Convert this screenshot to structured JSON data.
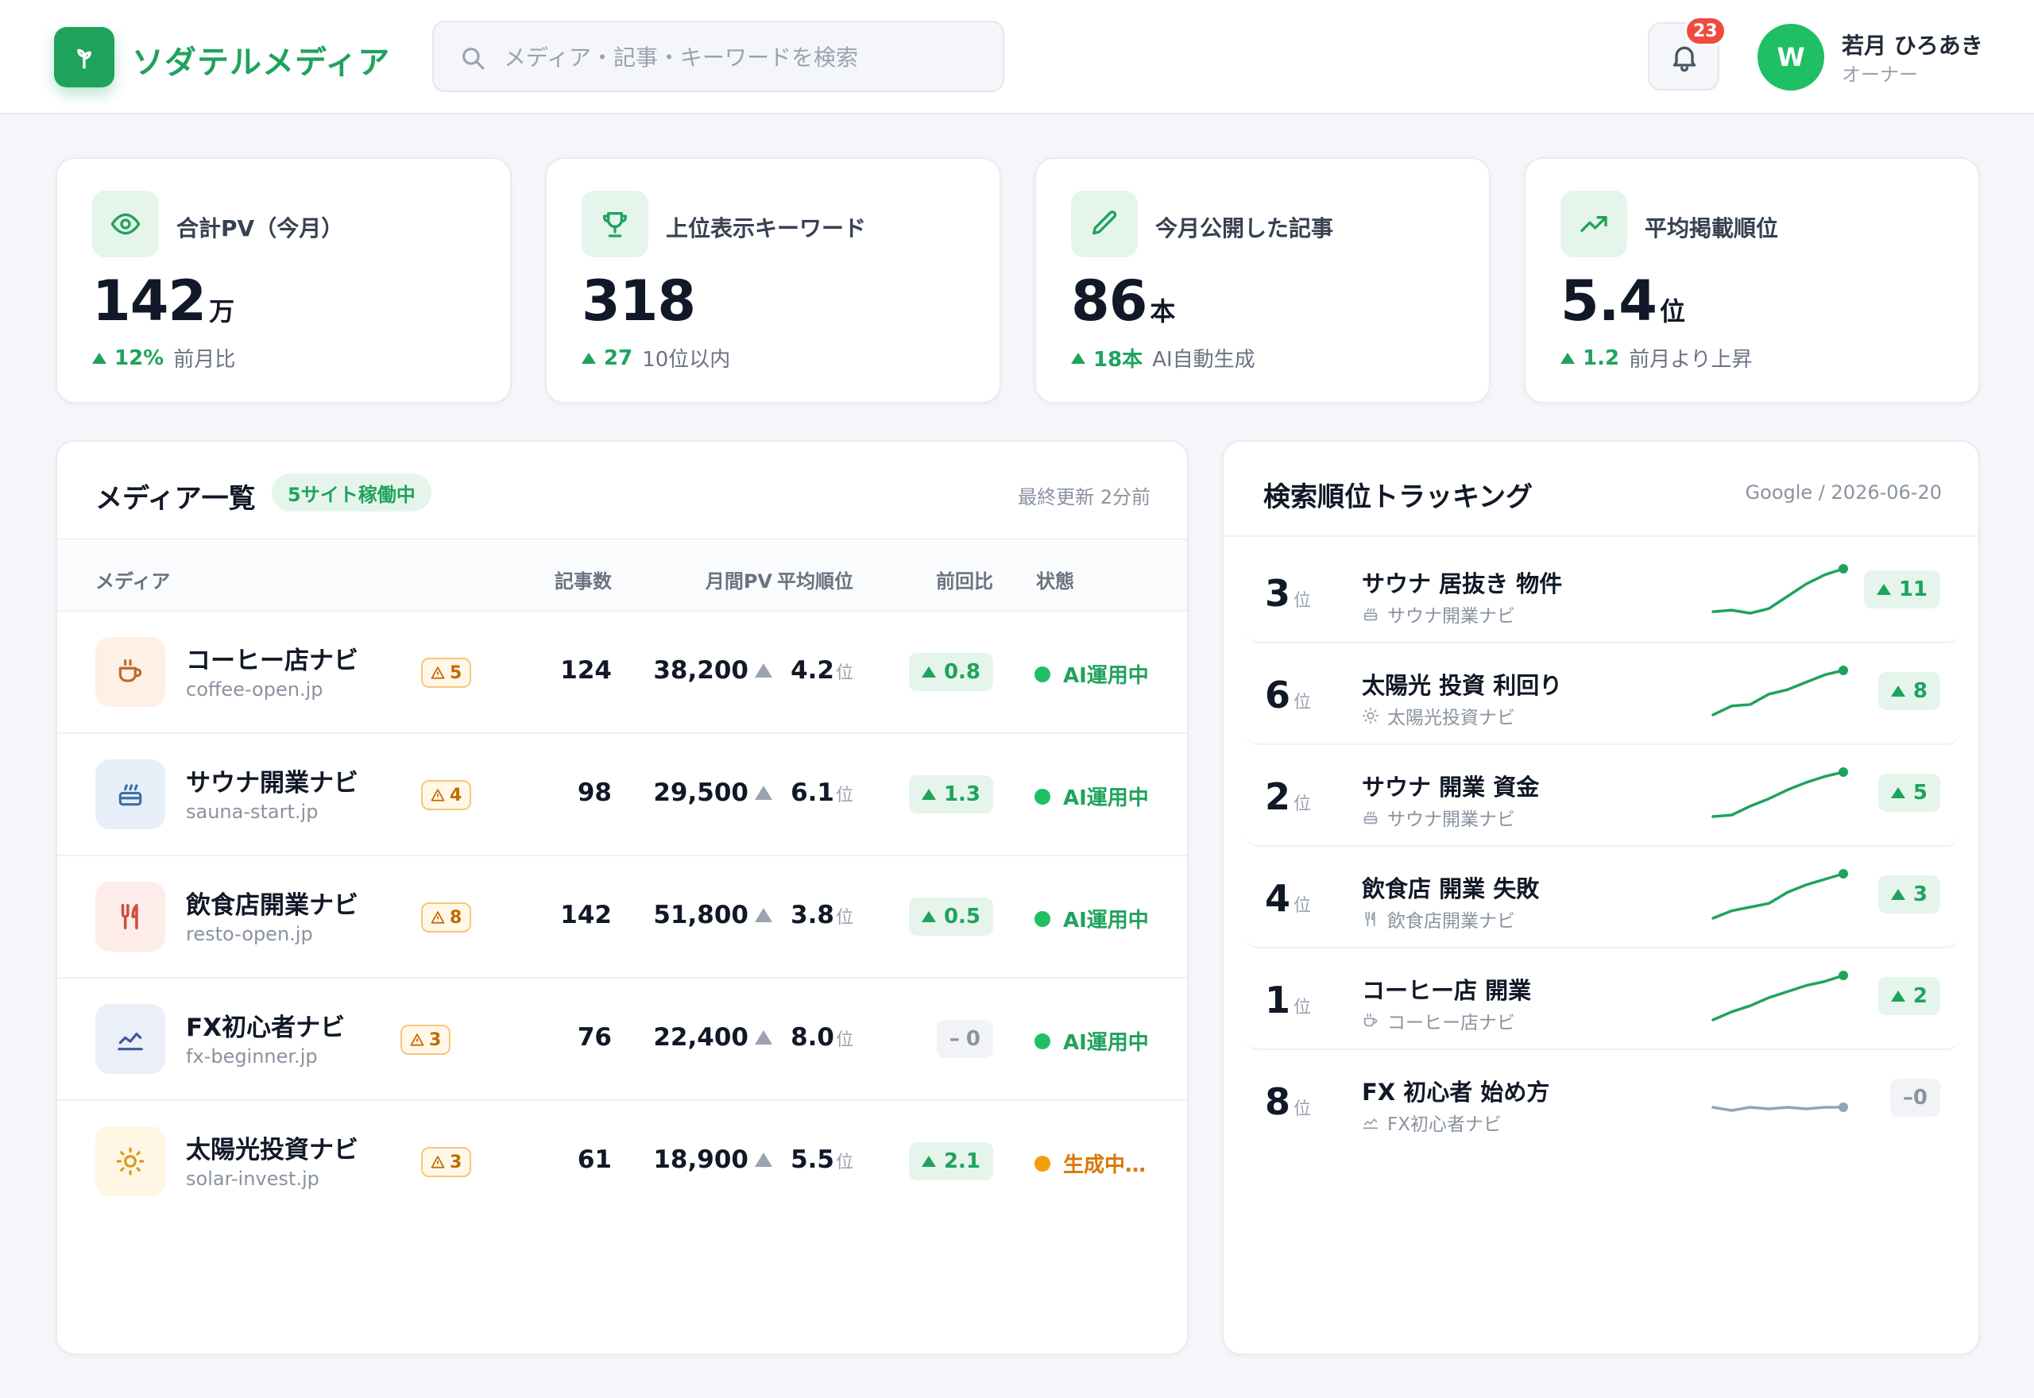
{
  "app": {
    "name": "ソダテルメディア",
    "accent": "#1fa35c"
  },
  "search": {
    "placeholder": "メディア・記事・キーワードを検索",
    "value": ""
  },
  "notifications": {
    "count": "23"
  },
  "user": {
    "initial": "W",
    "name": "若月 ひろあき",
    "role": "オーナー"
  },
  "stats": [
    {
      "icon": "eye-icon",
      "label": "合計PV（今月）",
      "value": "142",
      "unit": "万",
      "delta": "12%",
      "note": "前月比"
    },
    {
      "icon": "trophy-icon",
      "label": "上位表示キーワード",
      "value": "318",
      "unit": "",
      "delta": "27",
      "note": "10位以内"
    },
    {
      "icon": "pencil-icon",
      "label": "今月公開した記事",
      "value": "86",
      "unit": "本",
      "delta": "18本",
      "note": "AI自動生成"
    },
    {
      "icon": "trending-up-icon",
      "label": "平均掲載順位",
      "value": "5.4",
      "unit": "位",
      "delta": "1.2",
      "note": "前月より上昇"
    }
  ],
  "media": {
    "title": "メディア一覧",
    "badge": "5サイト稼働中",
    "updated": "最終更新 2分前",
    "columns": [
      "メディア",
      "記事数",
      "月間PV",
      "平均順位",
      "前回比",
      "状態"
    ],
    "rank_unit": "位",
    "rows": [
      {
        "icon": "coffee-icon",
        "name": "コーヒー店ナビ",
        "domain": "coffee-open.jp",
        "warnings": "5",
        "articles": "124",
        "pv": "38,200",
        "rank": "4.2",
        "change": "0.8",
        "change_dir": "up",
        "status": "AI運用中",
        "status_color": "#1fbf66"
      },
      {
        "icon": "sauna-icon",
        "name": "サウナ開業ナビ",
        "domain": "sauna-start.jp",
        "warnings": "4",
        "articles": "98",
        "pv": "29,500",
        "rank": "6.1",
        "change": "1.3",
        "change_dir": "up",
        "status": "AI運用中",
        "status_color": "#1fbf66"
      },
      {
        "icon": "utensils-icon",
        "name": "飲食店開業ナビ",
        "domain": "resto-open.jp",
        "warnings": "8",
        "articles": "142",
        "pv": "51,800",
        "rank": "3.8",
        "change": "0.5",
        "change_dir": "up",
        "status": "AI運用中",
        "status_color": "#1fbf66"
      },
      {
        "icon": "chart-line-icon",
        "name": "FX初心者ナビ",
        "domain": "fx-beginner.jp",
        "warnings": "3",
        "articles": "76",
        "pv": "22,400",
        "rank": "8.0",
        "change": "0",
        "change_dir": "flat",
        "status": "AI運用中",
        "status_color": "#1fbf66"
      },
      {
        "icon": "sun-icon",
        "name": "太陽光投資ナビ",
        "domain": "solar-invest.jp",
        "warnings": "3",
        "articles": "61",
        "pv": "18,900",
        "rank": "5.5",
        "change": "2.1",
        "change_dir": "up",
        "status": "生成中…",
        "status_color": "#f59e0b"
      }
    ]
  },
  "tracking": {
    "title": "検索順位トラッキング",
    "meta": "Google / 2026-06-20",
    "rank_unit": "位",
    "rows": [
      {
        "rank": "3",
        "keyword": "サウナ 居抜き 物件",
        "site": "サウナ開業ナビ",
        "site_icon": "sauna-icon",
        "change": "11",
        "change_dir": "up",
        "trend": [
          28,
          27,
          29,
          26,
          18,
          10,
          4,
          0
        ]
      },
      {
        "rank": "6",
        "keyword": "太陽光 投資 利回り",
        "site": "太陽光投資ナビ",
        "site_icon": "sun-icon",
        "change": "8",
        "change_dir": "up",
        "trend": [
          30,
          24,
          23,
          16,
          13,
          8,
          3,
          0
        ]
      },
      {
        "rank": "2",
        "keyword": "サウナ 開業 資金",
        "site": "サウナ開業ナビ",
        "site_icon": "sauna-icon",
        "change": "5",
        "change_dir": "up",
        "trend": [
          30,
          29,
          23,
          18,
          12,
          7,
          3,
          0
        ]
      },
      {
        "rank": "4",
        "keyword": "飲食店 開業 失敗",
        "site": "飲食店開業ナビ",
        "site_icon": "utensils-icon",
        "change": "3",
        "change_dir": "up",
        "trend": [
          24,
          20,
          18,
          16,
          10,
          6,
          3,
          0
        ]
      },
      {
        "rank": "1",
        "keyword": "コーヒー店 開業",
        "site": "コーヒー店ナビ",
        "site_icon": "coffee-icon",
        "change": "2",
        "change_dir": "up",
        "trend": [
          22,
          18,
          15,
          11,
          8,
          5,
          3,
          0
        ]
      },
      {
        "rank": "8",
        "keyword": "FX 初心者 始め方",
        "site": "FX初心者ナビ",
        "site_icon": "chart-line-icon",
        "change": "0",
        "change_dir": "flat",
        "trend": [
          0,
          1,
          0,
          0.5,
          0,
          0.5,
          0,
          0
        ]
      }
    ]
  }
}
